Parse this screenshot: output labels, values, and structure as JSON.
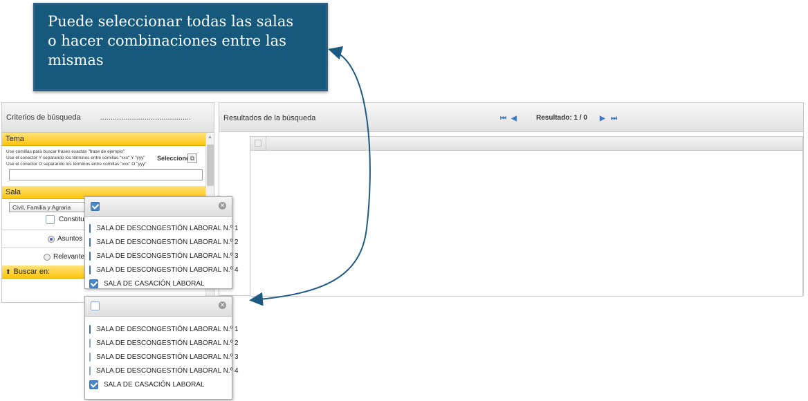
{
  "callout": {
    "lines": [
      "Puede seleccionar todas las salas",
      "o hacer combinaciones entre las",
      "mismas"
    ]
  },
  "left_panel": {
    "title": "Criterios de búsqueda",
    "dots": "...........................................",
    "tema": {
      "header": "Tema",
      "hints": [
        "Use comillas para buscar frases exactas \"frase de ejemplo\"",
        "Use el conector Y separando los términos entre comillas \"xxx\" Y \"yyy\"",
        "Use el conector O separando los términos entre comillas \"xxx\" O \"yyy\""
      ],
      "select_label": "Seleccione:",
      "input_value": ""
    },
    "sala": {
      "header": "Sala",
      "select_value": "Civil, Familia y Agraria",
      "checkbox_label": "Constitucional"
    },
    "radios": [
      {
        "label": "Asuntos de",
        "checked": true
      },
      {
        "label": "Relevantes",
        "checked": false
      }
    ],
    "buscar_en": {
      "header": "Buscar en:"
    }
  },
  "results": {
    "title": "Resultados de la búsqueda",
    "result_label": "Resultado: 1 / 0"
  },
  "popup_all": {
    "header_checked": true,
    "items": [
      {
        "label": "SALA DE DESCONGESTIÓN LABORAL N.º 1",
        "checked": true
      },
      {
        "label": "SALA DE DESCONGESTIÓN LABORAL N.º 2",
        "checked": true
      },
      {
        "label": "SALA DE DESCONGESTIÓN LABORAL N.º 3",
        "checked": true
      },
      {
        "label": "SALA DE DESCONGESTIÓN LABORAL N.º 4",
        "checked": true
      },
      {
        "label": "SALA DE CASACIÓN LABORAL",
        "checked": true
      }
    ]
  },
  "popup_combo": {
    "header_checked": false,
    "items": [
      {
        "label": "SALA DE DESCONGESTIÓN LABORAL N.º 1",
        "checked": true
      },
      {
        "label": "SALA DE DESCONGESTIÓN LABORAL N.º 2",
        "checked": false
      },
      {
        "label": "SALA DE DESCONGESTIÓN LABORAL N.º 3",
        "checked": false
      },
      {
        "label": "SALA DE DESCONGESTIÓN LABORAL N.º 4",
        "checked": false
      },
      {
        "label": "SALA DE CASACIÓN LABORAL",
        "checked": true
      }
    ]
  },
  "colors": {
    "callout_bg": "#17597c",
    "arrow": "#1d5a82",
    "tema_header": "#fcc60c",
    "checkbox_on": "#4b86c8"
  }
}
